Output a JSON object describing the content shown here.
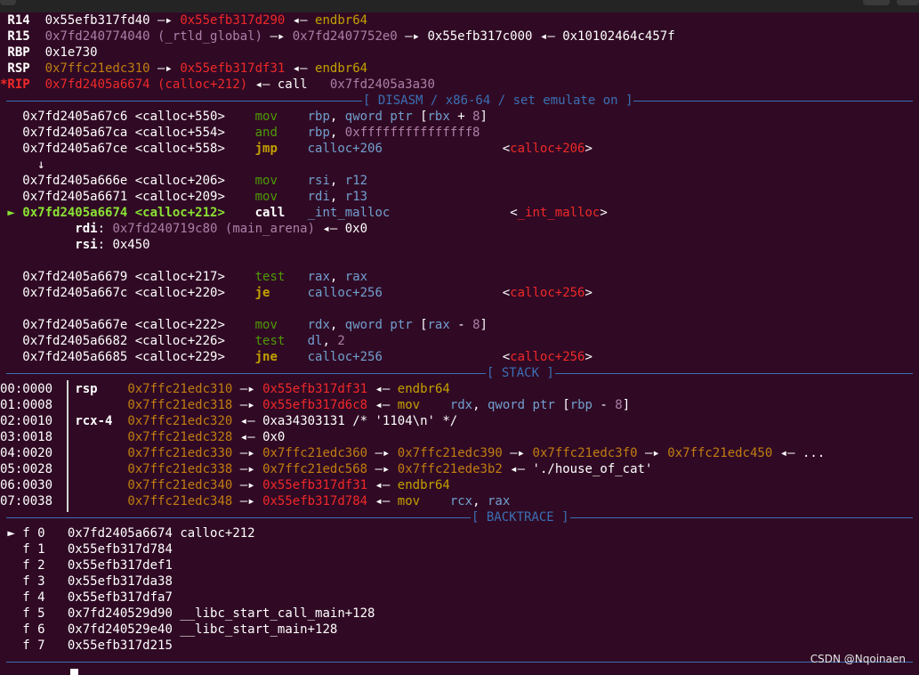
{
  "registers": [
    {
      "name": "R14",
      "parts": [
        [
          "w",
          "0x55efb317fd40"
        ],
        [
          "w",
          " —▸ "
        ],
        [
          "red",
          "0x55efb317d290"
        ],
        [
          "w",
          " ◂— "
        ],
        [
          "yel",
          "endbr64"
        ]
      ]
    },
    {
      "name": "R15",
      "parts": [
        [
          "pur",
          "0x7fd240774040 (_rtld_global)"
        ],
        [
          "w",
          " —▸ "
        ],
        [
          "pur",
          "0x7fd2407752e0"
        ],
        [
          "w",
          " —▸ "
        ],
        [
          "w",
          "0x55efb317c000"
        ],
        [
          "w",
          " ◂— "
        ],
        [
          "w",
          "0x10102464c457f"
        ]
      ]
    },
    {
      "name": "RBP",
      "parts": [
        [
          "w",
          "0x1e730"
        ]
      ]
    },
    {
      "name": "RSP",
      "parts": [
        [
          "brn",
          "0x7ffc21edc310"
        ],
        [
          "w",
          " —▸ "
        ],
        [
          "red",
          "0x55efb317df31"
        ],
        [
          "w",
          " ◂— "
        ],
        [
          "yel",
          "endbr64"
        ]
      ]
    },
    {
      "name": "*RIP",
      "parts": [
        [
          "red",
          "0x7fd2405a6674 (calloc+212)"
        ],
        [
          "w",
          " ◂— "
        ],
        [
          "w",
          "call   "
        ],
        [
          "pur",
          "0x7fd2405a3a30"
        ]
      ]
    }
  ],
  "disasm_header": "[ DISASM / x86-64 / set emulate on ]",
  "disasm": [
    {
      "addr": "0x7fd2405a67c6 <calloc+550>",
      "mn": "mov",
      "mc": "grn",
      "ops": [
        [
          "blu",
          "rbp"
        ],
        [
          "w",
          ", "
        ],
        [
          "blu",
          "qword ptr "
        ],
        [
          "w",
          "["
        ],
        [
          "blu",
          "rbx"
        ],
        [
          "w",
          " + "
        ],
        [
          "pur",
          "8"
        ],
        [
          "w",
          "]"
        ]
      ]
    },
    {
      "addr": "0x7fd2405a67ca <calloc+554>",
      "mn": "and",
      "mc": "grn",
      "ops": [
        [
          "blu",
          "rbp"
        ],
        [
          "w",
          ", "
        ],
        [
          "pur",
          "0xfffffffffffffff8"
        ]
      ]
    },
    {
      "addr": "0x7fd2405a67ce <calloc+558>",
      "mn": "jmp",
      "mc": "yel",
      "bold": true,
      "ops": [
        [
          "blu",
          "calloc+206"
        ]
      ],
      "target": "<calloc+206>"
    },
    {
      "arrow": "↓"
    },
    {
      "addr": "0x7fd2405a666e <calloc+206>",
      "mn": "mov",
      "mc": "grn",
      "ops": [
        [
          "blu",
          "rsi"
        ],
        [
          "w",
          ", "
        ],
        [
          "blu",
          "r12"
        ]
      ]
    },
    {
      "addr": "0x7fd2405a6671 <calloc+209>",
      "mn": "mov",
      "mc": "grn",
      "ops": [
        [
          "blu",
          "rdi"
        ],
        [
          "w",
          ", "
        ],
        [
          "blu",
          "r13"
        ]
      ]
    },
    {
      "addr": "0x7fd2405a6674 <calloc+212>",
      "mn": "call",
      "mc": "w",
      "bold": true,
      "current": true,
      "ops": [
        [
          "blu",
          "_int_malloc"
        ]
      ],
      "target": "<_int_malloc>"
    },
    {
      "arg": "rdi",
      "parts": [
        [
          "pur",
          "0x7fd240719c80 (main_arena)"
        ],
        [
          "w",
          " ◂— "
        ],
        [
          "w",
          "0x0"
        ]
      ]
    },
    {
      "arg": "rsi",
      "parts": [
        [
          "w",
          "0x450"
        ]
      ]
    },
    {
      "blank": true
    },
    {
      "addr": "0x7fd2405a6679 <calloc+217>",
      "mn": "test",
      "mc": "grn",
      "ops": [
        [
          "blu",
          "rax"
        ],
        [
          "w",
          ", "
        ],
        [
          "blu",
          "rax"
        ]
      ]
    },
    {
      "addr": "0x7fd2405a667c <calloc+220>",
      "mn": "je",
      "mc": "yel",
      "bold": true,
      "ops": [
        [
          "blu",
          "calloc+256"
        ]
      ],
      "target": "<calloc+256>"
    },
    {
      "blank": true
    },
    {
      "addr": "0x7fd2405a667e <calloc+222>",
      "mn": "mov",
      "mc": "grn",
      "ops": [
        [
          "blu",
          "rdx"
        ],
        [
          "w",
          ", "
        ],
        [
          "blu",
          "qword ptr "
        ],
        [
          "w",
          "["
        ],
        [
          "blu",
          "rax"
        ],
        [
          "w",
          " - "
        ],
        [
          "pur",
          "8"
        ],
        [
          "w",
          "]"
        ]
      ]
    },
    {
      "addr": "0x7fd2405a6682 <calloc+226>",
      "mn": "test",
      "mc": "grn",
      "ops": [
        [
          "blu",
          "dl"
        ],
        [
          "w",
          ", "
        ],
        [
          "pur",
          "2"
        ]
      ]
    },
    {
      "addr": "0x7fd2405a6685 <calloc+229>",
      "mn": "jne",
      "mc": "yel",
      "bold": true,
      "ops": [
        [
          "blu",
          "calloc+256"
        ]
      ],
      "target": "<calloc+256>"
    }
  ],
  "stack_header": "[ STACK ]",
  "stack": [
    {
      "off": "00:0000",
      "reg": "rsp",
      "parts": [
        [
          "brn",
          "0x7ffc21edc310"
        ],
        [
          "w",
          " —▸ "
        ],
        [
          "red",
          "0x55efb317df31"
        ],
        [
          "w",
          " ◂— "
        ],
        [
          "yel",
          "endbr64"
        ]
      ]
    },
    {
      "off": "01:0008",
      "reg": "",
      "parts": [
        [
          "brn",
          "0x7ffc21edc318"
        ],
        [
          "w",
          " —▸ "
        ],
        [
          "red",
          "0x55efb317d6c8"
        ],
        [
          "w",
          " ◂— "
        ],
        [
          "yel",
          "mov    "
        ],
        [
          "blu",
          "rdx"
        ],
        [
          "w",
          ", "
        ],
        [
          "blu",
          "qword ptr "
        ],
        [
          "w",
          "["
        ],
        [
          "blu",
          "rbp"
        ],
        [
          "w",
          " - "
        ],
        [
          "pur",
          "8"
        ],
        [
          "w",
          "]"
        ]
      ]
    },
    {
      "off": "02:0010",
      "reg": "rcx-4",
      "parts": [
        [
          "brn",
          "0x7ffc21edc320"
        ],
        [
          "w",
          " ◂— "
        ],
        [
          "w",
          "0xa34303131 /* '1104\\n' */"
        ]
      ]
    },
    {
      "off": "03:0018",
      "reg": "",
      "parts": [
        [
          "brn",
          "0x7ffc21edc328"
        ],
        [
          "w",
          " ◂— "
        ],
        [
          "w",
          "0x0"
        ]
      ]
    },
    {
      "off": "04:0020",
      "reg": "",
      "parts": [
        [
          "brn",
          "0x7ffc21edc330"
        ],
        [
          "w",
          " —▸ "
        ],
        [
          "brn",
          "0x7ffc21edc360"
        ],
        [
          "w",
          " —▸ "
        ],
        [
          "brn",
          "0x7ffc21edc390"
        ],
        [
          "w",
          " —▸ "
        ],
        [
          "brn",
          "0x7ffc21edc3f0"
        ],
        [
          "w",
          " —▸ "
        ],
        [
          "brn",
          "0x7ffc21edc450"
        ],
        [
          "w",
          " ◂— ..."
        ]
      ]
    },
    {
      "off": "05:0028",
      "reg": "",
      "parts": [
        [
          "brn",
          "0x7ffc21edc338"
        ],
        [
          "w",
          " —▸ "
        ],
        [
          "brn",
          "0x7ffc21edc568"
        ],
        [
          "w",
          " —▸ "
        ],
        [
          "brn",
          "0x7ffc21ede3b2"
        ],
        [
          "w",
          " ◂— "
        ],
        [
          "w",
          "'./house_of_cat'"
        ]
      ]
    },
    {
      "off": "06:0030",
      "reg": "",
      "parts": [
        [
          "brn",
          "0x7ffc21edc340"
        ],
        [
          "w",
          " —▸ "
        ],
        [
          "red",
          "0x55efb317df31"
        ],
        [
          "w",
          " ◂— "
        ],
        [
          "yel",
          "endbr64"
        ]
      ]
    },
    {
      "off": "07:0038",
      "reg": "",
      "parts": [
        [
          "brn",
          "0x7ffc21edc348"
        ],
        [
          "w",
          " —▸ "
        ],
        [
          "red",
          "0x55efb317d784"
        ],
        [
          "w",
          " ◂— "
        ],
        [
          "yel",
          "mov    "
        ],
        [
          "blu",
          "rcx"
        ],
        [
          "w",
          ", "
        ],
        [
          "blu",
          "rax"
        ]
      ]
    }
  ],
  "backtrace_header": "[ BACKTRACE ]",
  "backtrace": [
    {
      "frame": "f 0",
      "addr": "0x7fd2405a6674",
      "sym": "calloc+212",
      "current": true
    },
    {
      "frame": "f 1",
      "addr": "0x55efb317d784",
      "sym": ""
    },
    {
      "frame": "f 2",
      "addr": "0x55efb317def1",
      "sym": ""
    },
    {
      "frame": "f 3",
      "addr": "0x55efb317da38",
      "sym": ""
    },
    {
      "frame": "f 4",
      "addr": "0x55efb317dfa7",
      "sym": ""
    },
    {
      "frame": "f 5",
      "addr": "0x7fd240529d90",
      "sym": "__libc_start_call_main+128"
    },
    {
      "frame": "f 6",
      "addr": "0x7fd240529e40",
      "sym": "__libc_start_main+128"
    },
    {
      "frame": "f 7",
      "addr": "0x55efb317d215",
      "sym": ""
    }
  ],
  "watermark": "CSDN @Nqoinaen",
  "colors": {
    "background": "#300a24",
    "separator": "#3b6fb4",
    "pointer": "#ef2929",
    "stack_addr": "#c17d11",
    "symbol": "#ad7fa8",
    "instr": "#c4a000"
  }
}
